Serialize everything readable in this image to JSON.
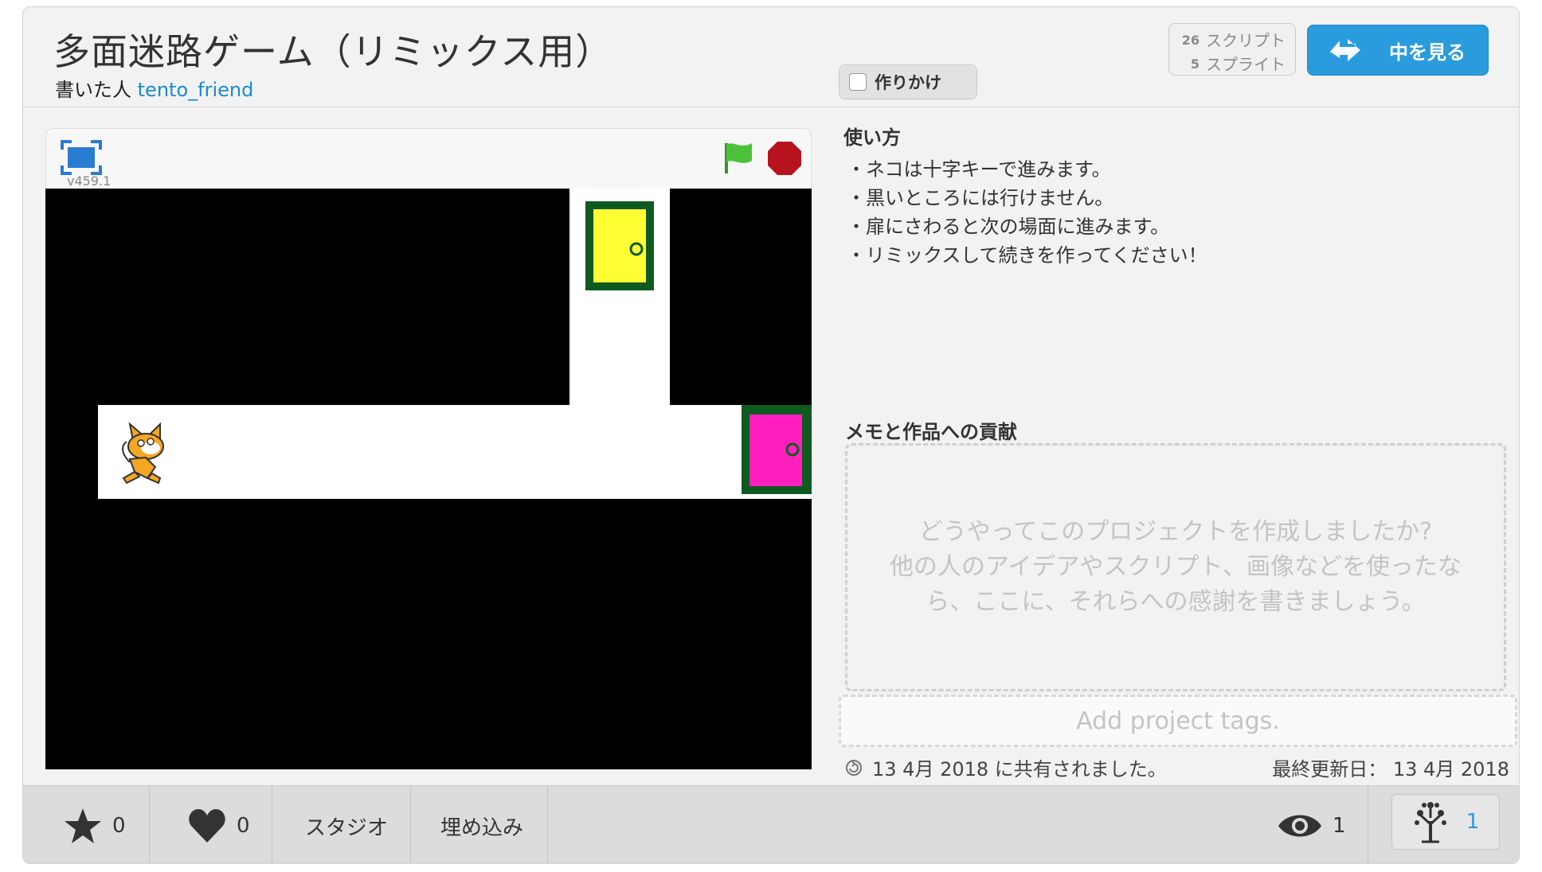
{
  "header": {
    "title": "多面迷路ゲーム（リミックス用）",
    "author_prefix": "書いた人",
    "author": "tento_friend",
    "wip_label": "作りかけ",
    "scripts_count": "26",
    "scripts_label": "スクリプト",
    "sprites_count": "5",
    "sprites_label": "スプライト",
    "see_inside_label": "中を見る"
  },
  "player": {
    "version": "v459.1",
    "icons": [
      "fullscreen-icon",
      "green-flag-icon",
      "stop-icon"
    ]
  },
  "instructions": {
    "heading": "使い方",
    "lines": [
      "・ネコは十字キーで進みます。",
      "・黒いところには行けません。",
      "・扉にさわると次の場面に進みます。",
      "・リミックスして続きを作ってください！"
    ]
  },
  "notes": {
    "heading": "メモと作品への貢献",
    "placeholder_line1": "どうやってこのプロジェクトを作成しましたか?",
    "placeholder_line2": "他の人のアイデアやスクリプト、画像などを使ったな",
    "placeholder_line3": "ら、ここに、それらへの感謝を書きましょう。"
  },
  "tags": {
    "placeholder": "Add project tags."
  },
  "dates": {
    "shared": "13 4月 2018 に共有されました。",
    "updated_label": "最終更新日：",
    "updated": "13 4月 2018"
  },
  "bottom": {
    "favorites": "0",
    "loves": "0",
    "studio_label": "スタジオ",
    "embed_label": "埋め込み",
    "views": "1",
    "remixes": "1"
  },
  "colors": {
    "accent": "#2a9cde",
    "link": "#1a8bcf",
    "door_yellow": "#ffff33",
    "door_pink": "#ff1fbf",
    "door_frame": "#0f5a1f"
  }
}
